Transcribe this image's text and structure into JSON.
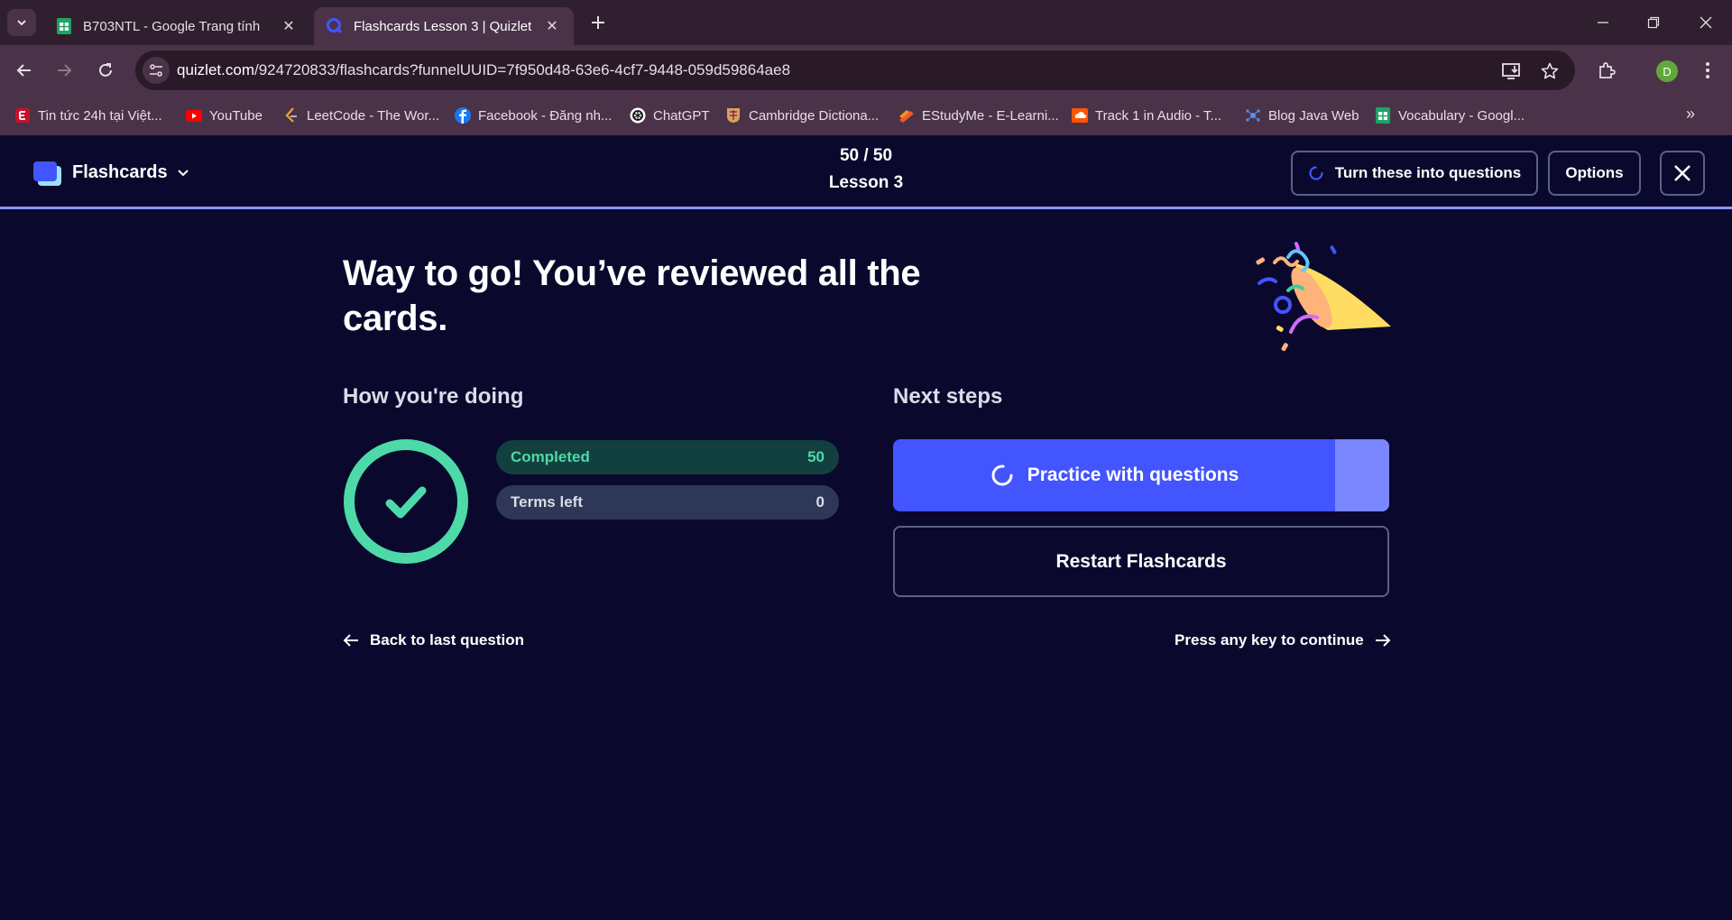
{
  "browser": {
    "tabs": [
      {
        "title": "B703NTL - Google Trang tính",
        "icon": "google-sheets-icon",
        "active": false
      },
      {
        "title": "Flashcards Lesson 3 | Quizlet",
        "icon": "quizlet-icon",
        "active": true
      }
    ],
    "url_host": "quizlet.com",
    "url_path": "/924720833/flashcards?funnelUUID=7f950d48-63e6-4cf7-9448-059d59864ae8",
    "profile_initial": "D",
    "bookmarks": [
      {
        "label": "Tin tức 24h tại Việt...",
        "icon": "news-icon"
      },
      {
        "label": "YouTube",
        "icon": "youtube-icon"
      },
      {
        "label": "LeetCode - The Wor...",
        "icon": "leetcode-icon"
      },
      {
        "label": "Facebook - Đăng nh...",
        "icon": "facebook-icon"
      },
      {
        "label": "ChatGPT",
        "icon": "chatgpt-icon"
      },
      {
        "label": "Cambridge Dictiona...",
        "icon": "cambridge-icon"
      },
      {
        "label": "EStudyMe - E-Learni...",
        "icon": "estudyme-icon"
      },
      {
        "label": "Track 1 in Audio - T...",
        "icon": "soundcloud-icon"
      },
      {
        "label": "Blog Java Web",
        "icon": "blog-icon"
      },
      {
        "label": "Vocabulary - Googl...",
        "icon": "google-sheets-icon"
      }
    ]
  },
  "header": {
    "mode_label": "Flashcards",
    "progress_count": "50 / 50",
    "set_title": "Lesson 3",
    "turn_into_questions": "Turn these into questions",
    "options": "Options"
  },
  "main": {
    "headline": "Way to go! You’ve reviewed all the cards.",
    "how_title": "How you're doing",
    "next_title": "Next steps",
    "stats": {
      "completed_label": "Completed",
      "completed_value": "50",
      "terms_left_label": "Terms left",
      "terms_left_value": "0"
    },
    "practice_button": "Practice with questions",
    "restart_button": "Restart Flashcards",
    "back_link": "Back to last question",
    "continue_hint": "Press any key to continue"
  },
  "colors": {
    "page_bg": "#0a092d",
    "primary": "#4255ff",
    "success": "#4ed9a8",
    "chrome": "#4a3348"
  }
}
